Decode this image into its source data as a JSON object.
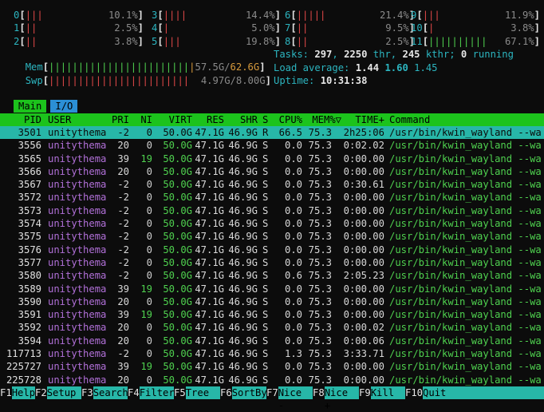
{
  "cpus": [
    {
      "id": "0",
      "bar": "|||",
      "color": "red",
      "pct": "10.1%"
    },
    {
      "id": "1",
      "bar": "||",
      "color": "red",
      "pct": "2.5%"
    },
    {
      "id": "2",
      "bar": "||",
      "color": "red",
      "pct": "3.8%"
    },
    {
      "id": "3",
      "bar": "||||",
      "color": "red",
      "pct": "14.4%"
    },
    {
      "id": "4",
      "bar": "|",
      "color": "red",
      "pct": "5.0%"
    },
    {
      "id": "5",
      "bar": "|||",
      "color": "red",
      "pct": "19.8%"
    },
    {
      "id": "6",
      "bar": "|||||",
      "color": "red",
      "pct": "21.4%"
    },
    {
      "id": "7",
      "bar": "||",
      "color": "red",
      "pct": "9.5%"
    },
    {
      "id": "8",
      "bar": "||",
      "color": "red",
      "pct": "2.5%"
    },
    {
      "id": "9",
      "bar": "|||",
      "color": "red",
      "pct": "11.9%"
    },
    {
      "id": "10",
      "bar": "|",
      "color": "red",
      "pct": "3.8%"
    },
    {
      "id": "11",
      "bar": "||||||||||",
      "color": "green",
      "pct": "67.1%"
    }
  ],
  "mem": {
    "label": "Mem",
    "bar_green": "||||||||||||||||||||||||",
    "bar_orange": "|",
    "used": "57.5G/",
    "total": "62.6G",
    "total_color": "#d79a3c"
  },
  "swp": {
    "label": "Swp",
    "bar": "||||||||||||||||||||||||",
    "value": "4.97G/8.00G"
  },
  "tasks": {
    "label": "Tasks:",
    "tasks": "297",
    "sep1": ",",
    "thr": "2250",
    "thr_label": "thr,",
    "kthr": "245",
    "kthr_label": "kthr;",
    "running": "0",
    "running_label": "running"
  },
  "load": {
    "label": "Load average:",
    "v1": "1.44",
    "v2": "1.60",
    "v3": "1.45"
  },
  "uptime": {
    "label": "Uptime:",
    "value": "10:31:38"
  },
  "tabs": [
    {
      "label": "Main"
    },
    {
      "label": "I/O"
    }
  ],
  "columns": [
    "PID",
    "USER",
    "PRI",
    "NI",
    "VIRT",
    "RES",
    "SHR",
    "S",
    "CPU%",
    "MEM%▽",
    "TIME+",
    "Command"
  ],
  "processes": [
    {
      "pid": "3501",
      "user": "unitythema",
      "pri": "-2",
      "ni": "0",
      "virt": "50.0G",
      "res": "47.1G",
      "shr": "46.9G",
      "s": "R",
      "cpu": "66.5",
      "mem": "75.3",
      "time": "2h25:06",
      "cmd": "/usr/bin/kwin_wayland --wa",
      "selected": true
    },
    {
      "pid": "3556",
      "user": "unitythema",
      "pri": "20",
      "ni": "0",
      "virt": "50.0G",
      "res": "47.1G",
      "shr": "46.9G",
      "s": "S",
      "cpu": "0.0",
      "mem": "75.3",
      "time": "0:02.02",
      "cmd": "/usr/bin/kwin_wayland --wa"
    },
    {
      "pid": "3565",
      "user": "unitythema",
      "pri": "39",
      "ni": "19",
      "virt": "50.0G",
      "res": "47.1G",
      "shr": "46.9G",
      "s": "S",
      "cpu": "0.0",
      "mem": "75.3",
      "time": "0:00.00",
      "cmd": "/usr/bin/kwin_wayland --wa"
    },
    {
      "pid": "3566",
      "user": "unitythema",
      "pri": "20",
      "ni": "0",
      "virt": "50.0G",
      "res": "47.1G",
      "shr": "46.9G",
      "s": "S",
      "cpu": "0.0",
      "mem": "75.3",
      "time": "0:00.00",
      "cmd": "/usr/bin/kwin_wayland --wa"
    },
    {
      "pid": "3567",
      "user": "unitythema",
      "pri": "-2",
      "ni": "0",
      "virt": "50.0G",
      "res": "47.1G",
      "shr": "46.9G",
      "s": "S",
      "cpu": "0.0",
      "mem": "75.3",
      "time": "0:30.61",
      "cmd": "/usr/bin/kwin_wayland --wa"
    },
    {
      "pid": "3572",
      "user": "unitythema",
      "pri": "-2",
      "ni": "0",
      "virt": "50.0G",
      "res": "47.1G",
      "shr": "46.9G",
      "s": "S",
      "cpu": "0.0",
      "mem": "75.3",
      "time": "0:00.00",
      "cmd": "/usr/bin/kwin_wayland --wa"
    },
    {
      "pid": "3573",
      "user": "unitythema",
      "pri": "-2",
      "ni": "0",
      "virt": "50.0G",
      "res": "47.1G",
      "shr": "46.9G",
      "s": "S",
      "cpu": "0.0",
      "mem": "75.3",
      "time": "0:00.00",
      "cmd": "/usr/bin/kwin_wayland --wa"
    },
    {
      "pid": "3574",
      "user": "unitythema",
      "pri": "-2",
      "ni": "0",
      "virt": "50.0G",
      "res": "47.1G",
      "shr": "46.9G",
      "s": "S",
      "cpu": "0.0",
      "mem": "75.3",
      "time": "0:00.00",
      "cmd": "/usr/bin/kwin_wayland --wa"
    },
    {
      "pid": "3575",
      "user": "unitythema",
      "pri": "-2",
      "ni": "0",
      "virt": "50.0G",
      "res": "47.1G",
      "shr": "46.9G",
      "s": "S",
      "cpu": "0.0",
      "mem": "75.3",
      "time": "0:00.00",
      "cmd": "/usr/bin/kwin_wayland --wa"
    },
    {
      "pid": "3576",
      "user": "unitythema",
      "pri": "-2",
      "ni": "0",
      "virt": "50.0G",
      "res": "47.1G",
      "shr": "46.9G",
      "s": "S",
      "cpu": "0.0",
      "mem": "75.3",
      "time": "0:00.00",
      "cmd": "/usr/bin/kwin_wayland --wa"
    },
    {
      "pid": "3577",
      "user": "unitythema",
      "pri": "-2",
      "ni": "0",
      "virt": "50.0G",
      "res": "47.1G",
      "shr": "46.9G",
      "s": "S",
      "cpu": "0.0",
      "mem": "75.3",
      "time": "0:00.00",
      "cmd": "/usr/bin/kwin_wayland --wa"
    },
    {
      "pid": "3580",
      "user": "unitythema",
      "pri": "-2",
      "ni": "0",
      "virt": "50.0G",
      "res": "47.1G",
      "shr": "46.9G",
      "s": "S",
      "cpu": "0.6",
      "mem": "75.3",
      "time": "2:05.23",
      "cmd": "/usr/bin/kwin_wayland --wa"
    },
    {
      "pid": "3589",
      "user": "unitythema",
      "pri": "39",
      "ni": "19",
      "virt": "50.0G",
      "res": "47.1G",
      "shr": "46.9G",
      "s": "S",
      "cpu": "0.0",
      "mem": "75.3",
      "time": "0:00.00",
      "cmd": "/usr/bin/kwin_wayland --wa"
    },
    {
      "pid": "3590",
      "user": "unitythema",
      "pri": "20",
      "ni": "0",
      "virt": "50.0G",
      "res": "47.1G",
      "shr": "46.9G",
      "s": "S",
      "cpu": "0.0",
      "mem": "75.3",
      "time": "0:00.00",
      "cmd": "/usr/bin/kwin_wayland --wa"
    },
    {
      "pid": "3591",
      "user": "unitythema",
      "pri": "39",
      "ni": "19",
      "virt": "50.0G",
      "res": "47.1G",
      "shr": "46.9G",
      "s": "S",
      "cpu": "0.0",
      "mem": "75.3",
      "time": "0:00.00",
      "cmd": "/usr/bin/kwin_wayland --wa"
    },
    {
      "pid": "3592",
      "user": "unitythema",
      "pri": "20",
      "ni": "0",
      "virt": "50.0G",
      "res": "47.1G",
      "shr": "46.9G",
      "s": "S",
      "cpu": "0.0",
      "mem": "75.3",
      "time": "0:00.02",
      "cmd": "/usr/bin/kwin_wayland --wa"
    },
    {
      "pid": "3594",
      "user": "unitythema",
      "pri": "20",
      "ni": "0",
      "virt": "50.0G",
      "res": "47.1G",
      "shr": "46.9G",
      "s": "S",
      "cpu": "0.0",
      "mem": "75.3",
      "time": "0:00.06",
      "cmd": "/usr/bin/kwin_wayland --wa"
    },
    {
      "pid": "117713",
      "user": "unitythema",
      "pri": "-2",
      "ni": "0",
      "virt": "50.0G",
      "res": "47.1G",
      "shr": "46.9G",
      "s": "S",
      "cpu": "1.3",
      "mem": "75.3",
      "time": "3:33.71",
      "cmd": "/usr/bin/kwin_wayland --wa"
    },
    {
      "pid": "225727",
      "user": "unitythema",
      "pri": "39",
      "ni": "19",
      "virt": "50.0G",
      "res": "47.1G",
      "shr": "46.9G",
      "s": "S",
      "cpu": "0.0",
      "mem": "75.3",
      "time": "0:00.00",
      "cmd": "/usr/bin/kwin_wayland --wa"
    },
    {
      "pid": "225728",
      "user": "unitythema",
      "pri": "20",
      "ni": "0",
      "virt": "50.0G",
      "res": "47.1G",
      "shr": "46.9G",
      "s": "S",
      "cpu": "0.0",
      "mem": "75.3",
      "time": "0:00.00",
      "cmd": "/usr/bin/kwin_wayland --wa"
    }
  ],
  "footer": [
    {
      "key": "F1",
      "label": "Help"
    },
    {
      "key": "F2",
      "label": "Setup"
    },
    {
      "key": "F3",
      "label": "Search"
    },
    {
      "key": "F4",
      "label": "Filter"
    },
    {
      "key": "F5",
      "label": "Tree"
    },
    {
      "key": "F6",
      "label": "SortBy"
    },
    {
      "key": "F7",
      "label": "Nice -"
    },
    {
      "key": "F8",
      "label": "Nice +"
    },
    {
      "key": "F9",
      "label": "Kill"
    },
    {
      "key": "F10",
      "label": "Quit"
    }
  ],
  "colors": {
    "header_bg": "#1cc31c",
    "selected_bg": "#27b7a8",
    "tab_io_bg": "#2b8fd6",
    "user": "#b170d8",
    "virt": "#4fd14f"
  }
}
